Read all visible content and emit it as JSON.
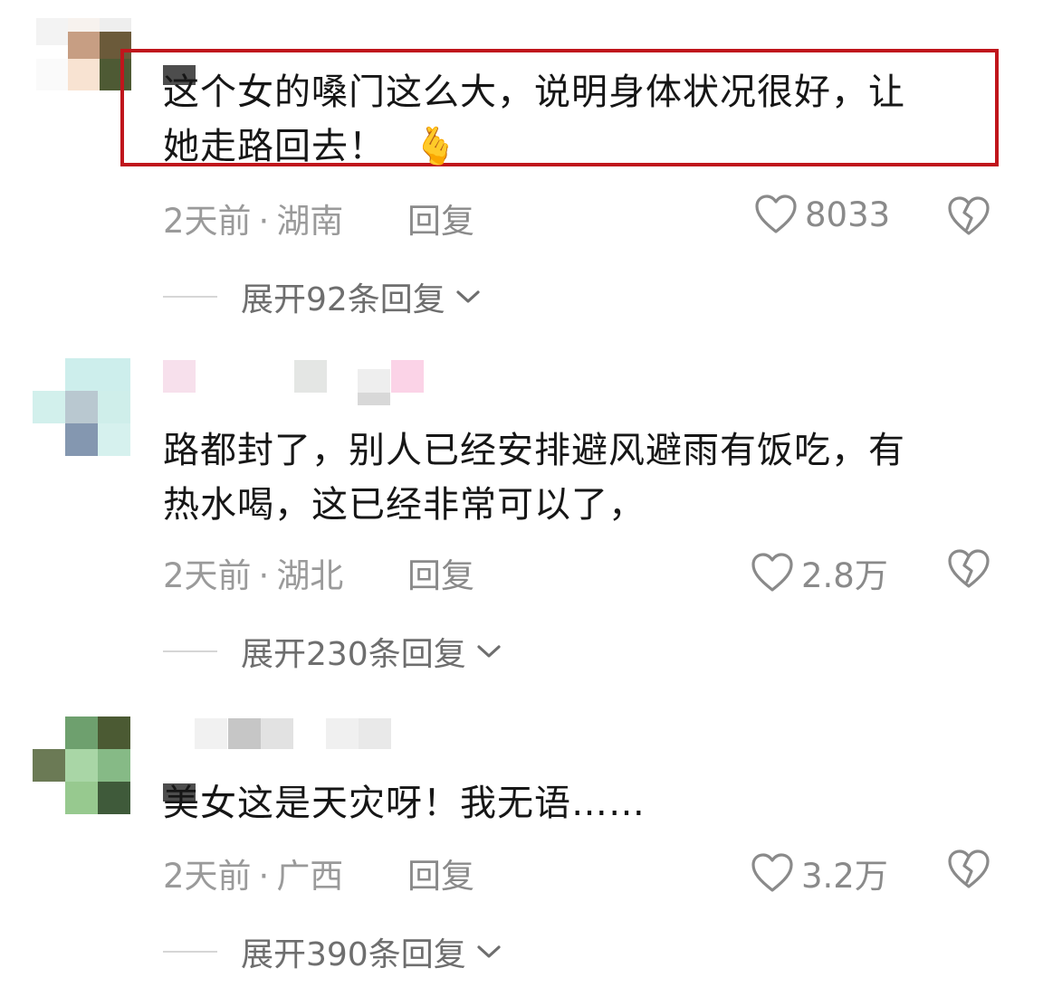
{
  "comments": [
    {
      "text_lines": [
        "这个女的嗓门这么大，说明身体状况很好，让",
        "她走路回去！"
      ],
      "emoji": "🫰",
      "time": "2天前",
      "separator": "·",
      "location": "湖南",
      "reply_label": "回复",
      "likes": "8033",
      "expand_label": "展开92条回复",
      "highlighted": true
    },
    {
      "text_lines": [
        "路都封了，别人已经安排避风避雨有饭吃，有",
        "热水喝，这已经非常可以了，"
      ],
      "time": "2天前",
      "separator": "·",
      "location": "湖北",
      "reply_label": "回复",
      "likes": "2.8万",
      "expand_label": "展开230条回复",
      "highlighted": false
    },
    {
      "text_lines": [
        "美女这是天灾呀！我无语……"
      ],
      "time": "2天前",
      "separator": "·",
      "location": "广西",
      "reply_label": "回复",
      "likes": "3.2万",
      "expand_label": "展开390条回复",
      "highlighted": false
    }
  ],
  "icons": {
    "like": "heart-outline-icon",
    "dislike": "broken-heart-icon",
    "expand": "chevron-down-icon"
  },
  "colors": {
    "highlight_border": "#c0161c",
    "meta_text": "#9a9a9a",
    "body_text": "#161616"
  }
}
